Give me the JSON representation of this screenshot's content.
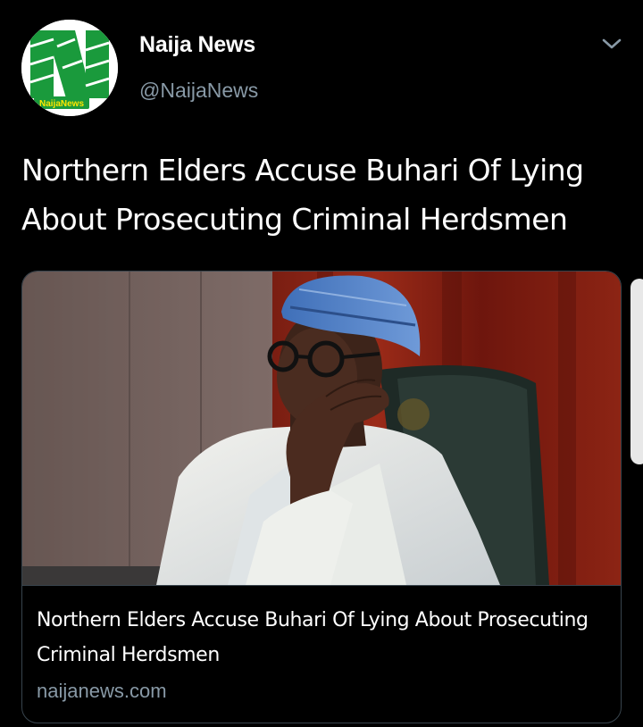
{
  "author": {
    "name": "Naija News",
    "handle": "@NaijaNews",
    "avatar_icon": "naija-news-logo-icon",
    "avatar_logo_text": "NaijaNews"
  },
  "menu": {
    "icon": "chevron-down-icon"
  },
  "tweet": {
    "text": "Northern Elders Accuse Buhari Of Lying About Prosecuting Criminal Herdsmen"
  },
  "card": {
    "title": "Northern Elders Accuse Buhari Of Lying About Prosecuting Criminal Herdsmen",
    "domain": "naijanews.com",
    "image_icon": "article-photo"
  },
  "colors": {
    "background": "#000000",
    "text_primary": "#ffffff",
    "text_secondary": "#8899a6",
    "border": "#38444d",
    "logo_green": "#1a9a3c"
  }
}
